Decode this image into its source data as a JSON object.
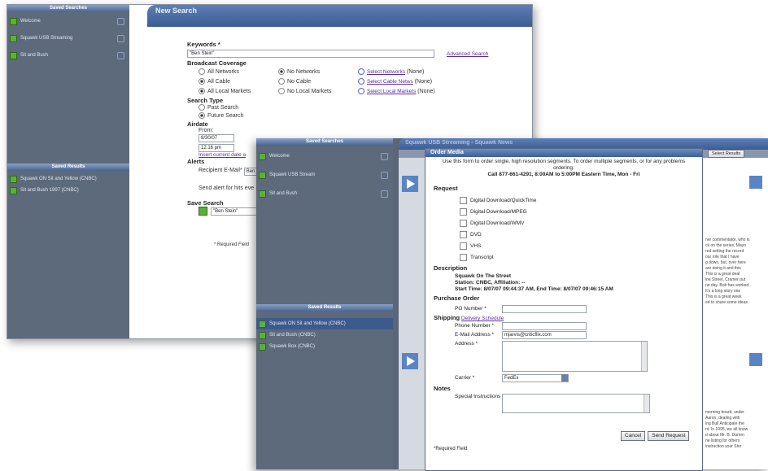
{
  "back_window": {
    "sidebar": {
      "saved_searches_header": "Saved Searches",
      "saved_searches": [
        "Welcome",
        "Squawk USB Streaming",
        "Sit and Bush"
      ],
      "saved_results_header": "Saved Results",
      "saved_results": [
        "Squawk ON Sit and Yellow (CNBC)",
        "Sit and Bush 1997 (CNBC)"
      ]
    },
    "title": "New Search",
    "keywords_label": "Keywords *",
    "keywords_value": "\"Ben Stein\"",
    "advanced_search_link": "Advanced Search",
    "broadcast_coverage_label": "Broadcast Coverage",
    "coverage_options": [
      {
        "col1": "All Networks",
        "col1_on": false,
        "col2": "No Networks",
        "col2_on": true,
        "col3": "Select Networks",
        "col3_suffix": "(None)"
      },
      {
        "col1": "All Cable",
        "col1_on": true,
        "col2": "No Cable",
        "col2_on": false,
        "col3": "Select Cable Netws",
        "col3_suffix": "(None)"
      },
      {
        "col1": "All Local Markets",
        "col1_on": true,
        "col2": "No Local Markets",
        "col2_on": false,
        "col3": "Select Local Markets",
        "col3_suffix": "(None)"
      }
    ],
    "search_type_label": "Search Type",
    "search_type_options": [
      {
        "label": "Past Search",
        "on": false
      },
      {
        "label": "Future Search",
        "on": true
      }
    ],
    "airdate_label": "Airdate",
    "airdate_from_label": "From:",
    "airdate_date": "8/30/07",
    "airdate_time": "12:16 pm",
    "airdate_link": "Insert current date a",
    "alerts_label": "Alerts",
    "alerts_row": "Recipient E-Mail*",
    "alerts_value": "Ben",
    "alerts_note": "Send alert for hits eve",
    "save_search_label": "Save Search",
    "save_search_value": "\"Ben Stein\"",
    "required_note": "* Required Field"
  },
  "front_window": {
    "window_title": "Squawk USB Streaming - Squawk News",
    "header_buttons": [
      "Select Results"
    ],
    "sidebar": {
      "saved_searches_header": "Saved Searches",
      "saved_searches": [
        "Welcome",
        "Squawk USB Stream",
        "Sit and Bush"
      ],
      "saved_results_header": "Saved Results",
      "saved_results": [
        "Squawk ON Sit and Yellow (CNBC)",
        "Sit and Bush (CNBC)",
        "Squawk Box (CNBC)"
      ]
    },
    "right_panel_text_1": [
      "ner commentator, who is",
      "ck on the series, Mayo",
      "red setting the record",
      "our role that I have",
      "g down, but, over here",
      "are doing it and this",
      "This is a great deal",
      "ine Street, Cramer put",
      "ne day. Bob has worked",
      "It's a long story one",
      "This is a great week",
      "ed to share some ideas"
    ],
    "right_panel_text_2": [
      "morning board, under",
      "Aaron, dealing with",
      "ing Bull Anticipate the",
      "nt. In 1995, we all know",
      "d about Mr. B. Darren",
      "ne listing for others",
      "instruction your Stor"
    ]
  },
  "modal": {
    "title": "Order Media",
    "intro": "Use this form to order single, high resolution segments. To order multiple segments, or for any problems ordering:",
    "call_line": "Call 877-661-4291, 8:00AM to 5:00PM Eastern Time, Mon - Fri",
    "request_label": "Request",
    "request_options": [
      "Digital Download/QuickTime",
      "Digital Download/MPEG",
      "Digital Download/WMV",
      "DVD",
      "VHS",
      "Transcript"
    ],
    "description_label": "Description",
    "description_title": "Squawk On The Street",
    "description_station": "Station: CNBC, Affiliation: --",
    "description_times": "Start Time: 8/07/07 09:44:37 AM, End Time: 8/07/07 09:46:15 AM",
    "purchase_label": "Purchase Order",
    "po_label": "PO Number *",
    "shipping_label": "Shipping",
    "delivery_link": "Delivery Schedule",
    "phone_label": "Phone Number *",
    "email_label": "E-Mail Address *",
    "email_value": "mjarvis@criticflix.com",
    "address_label": "Address *",
    "carrier_label": "Carrier *",
    "carrier_value": "FedEx",
    "notes_label": "Notes",
    "special_label": "Special Instructions",
    "cancel_button": "Cancel",
    "send_button": "Send Request",
    "required_note": "*Required Field"
  }
}
